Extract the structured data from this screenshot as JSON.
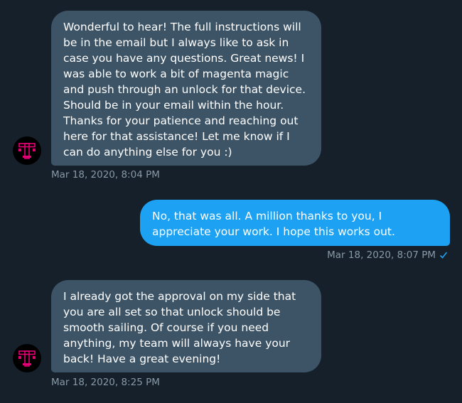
{
  "messages": [
    {
      "direction": "incoming",
      "text": "Wonderful to hear! The full instructions will be in the email but I always like to ask in case you have any questions. Great news! I was able to work a bit of magenta magic and push through an unlock for that device. Should be in your email within the hour. Thanks for your patience and reaching out here for that assistance! Let me know if I can do anything else for you :)",
      "timestamp": "Mar 18, 2020, 8:04 PM",
      "avatar_icon": "t-mobile-logo-icon"
    },
    {
      "direction": "outgoing",
      "text": "No, that was all. A million thanks to you, I appreciate your work. I hope this works out.",
      "timestamp": "Mar 18, 2020, 8:07 PM",
      "status_icon": "read-check-icon"
    },
    {
      "direction": "incoming",
      "text": "I already got the approval on my side that you are all set so that unlock should be smooth sailing. Of course if you need anything, my team will always have your back! Have a great evening!",
      "timestamp": "Mar 18, 2020, 8:25 PM",
      "avatar_icon": "t-mobile-logo-icon"
    }
  ],
  "colors": {
    "background": "#15202b",
    "incoming_bubble": "#3d5466",
    "outgoing_bubble": "#1da1f2",
    "timestamp": "#8899a6",
    "brand_magenta": "#e20074"
  }
}
